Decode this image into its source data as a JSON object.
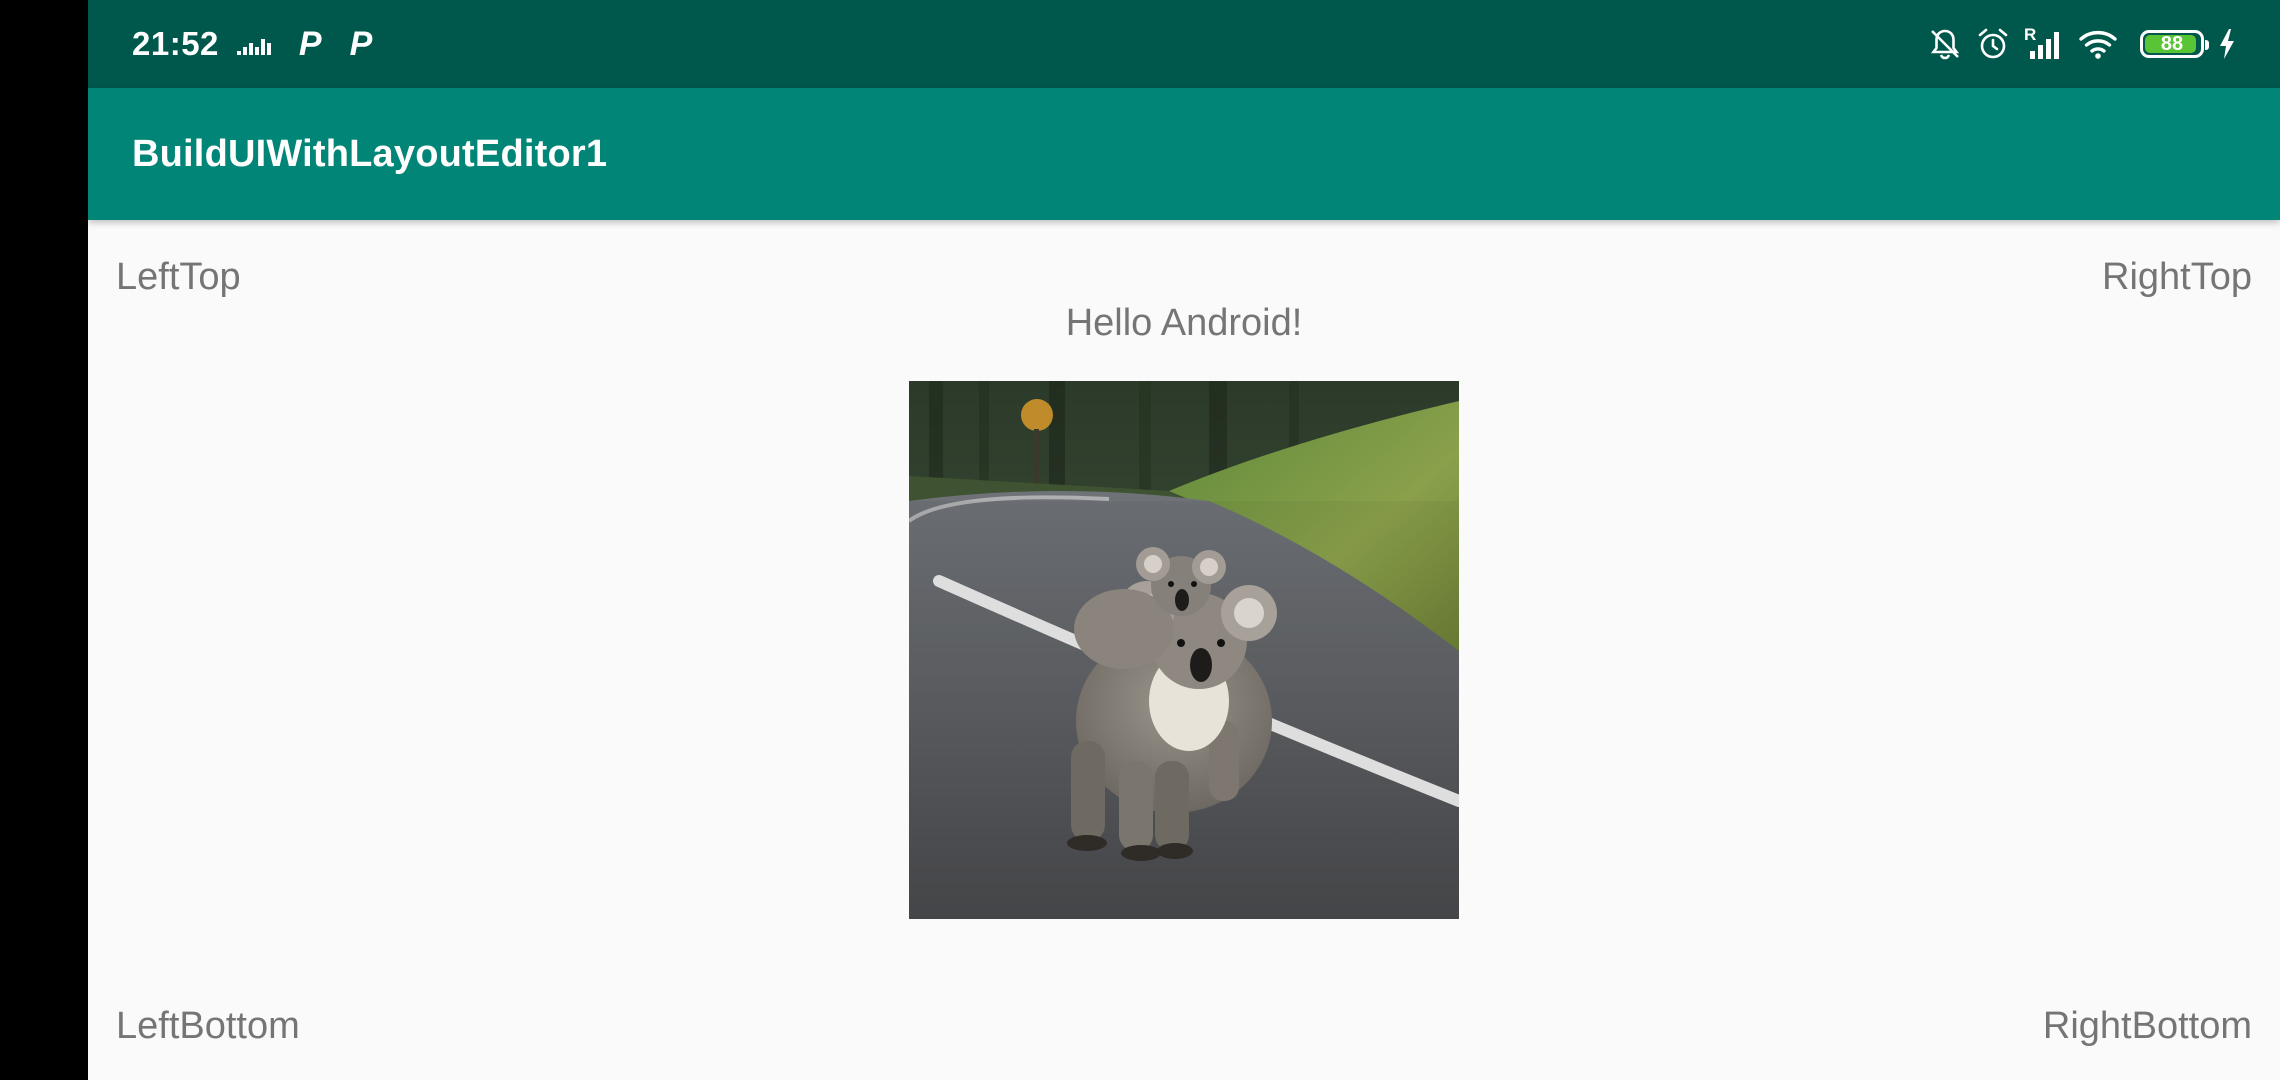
{
  "status_bar": {
    "time": "21:52",
    "battery_level": "88",
    "colors": {
      "background": "#00574b",
      "battery_fill": "#59c435"
    },
    "left_icons": [
      "equalizer-icon",
      "parking-app-icon",
      "parking-app-icon"
    ],
    "right_icons": [
      "bell-off-icon",
      "alarm-icon",
      "signal-roaming-icon",
      "wifi-icon",
      "battery-icon",
      "charging-icon"
    ],
    "roaming_letter": "R",
    "p_letter": "P"
  },
  "app_bar": {
    "title": "BuildUIWithLayoutEditor1",
    "color": "#008577"
  },
  "content": {
    "left_top": "LeftTop",
    "right_top": "RightTop",
    "hello": "Hello Android!",
    "left_bottom": "LeftBottom",
    "right_bottom": "RightBottom",
    "text_color": "#757575",
    "image": {
      "description_icon": "koala-photo"
    }
  }
}
